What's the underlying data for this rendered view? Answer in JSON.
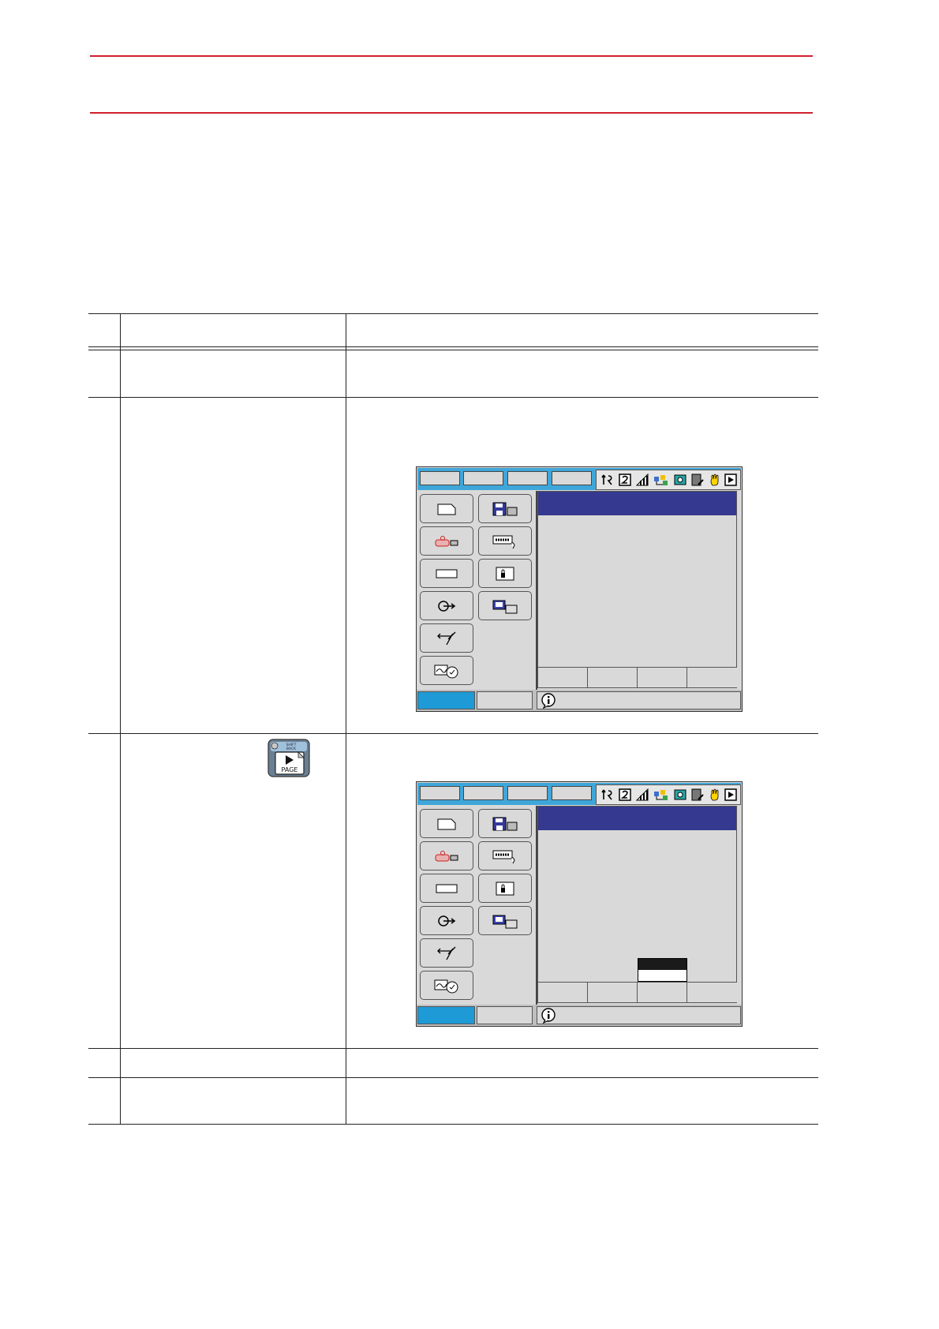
{
  "colors": {
    "rule": "#d0202e",
    "pendant_topbar": "#3fa6d9",
    "panel_header": "#35398f",
    "main_menu_active": "#1e9ad6",
    "screen_background": "#d9d9d9"
  },
  "page_key": {
    "top_label": "SHIFT",
    "sub_label": "BACK",
    "label": "PAGE",
    "icon": "play-triangle-icon"
  },
  "screens": [
    {
      "status_icons": [
        "axis-icon",
        "number-icon",
        "signal-icon",
        "link-icon",
        "camera-icon",
        "edit-icon",
        "hand-icon",
        "play-icon"
      ],
      "menu_icons_left": [
        "job-icon",
        "robot-icon",
        "variable-icon",
        "in-out-icon",
        "arc-icon",
        "display-icon"
      ],
      "menu_icons_right": [
        "floppy-icon",
        "keyboard-icon",
        "lock-icon",
        "monitor-icon"
      ],
      "popup_visible": false
    },
    {
      "status_icons": [
        "axis-icon",
        "number-icon",
        "signal-icon",
        "link-icon",
        "camera-icon",
        "edit-icon",
        "hand-icon",
        "play-icon"
      ],
      "menu_icons_left": [
        "job-icon",
        "robot-icon",
        "variable-icon",
        "in-out-icon",
        "arc-icon",
        "display-icon"
      ],
      "menu_icons_right": [
        "floppy-icon",
        "keyboard-icon",
        "lock-icon",
        "monitor-icon"
      ],
      "popup_visible": true
    }
  ]
}
